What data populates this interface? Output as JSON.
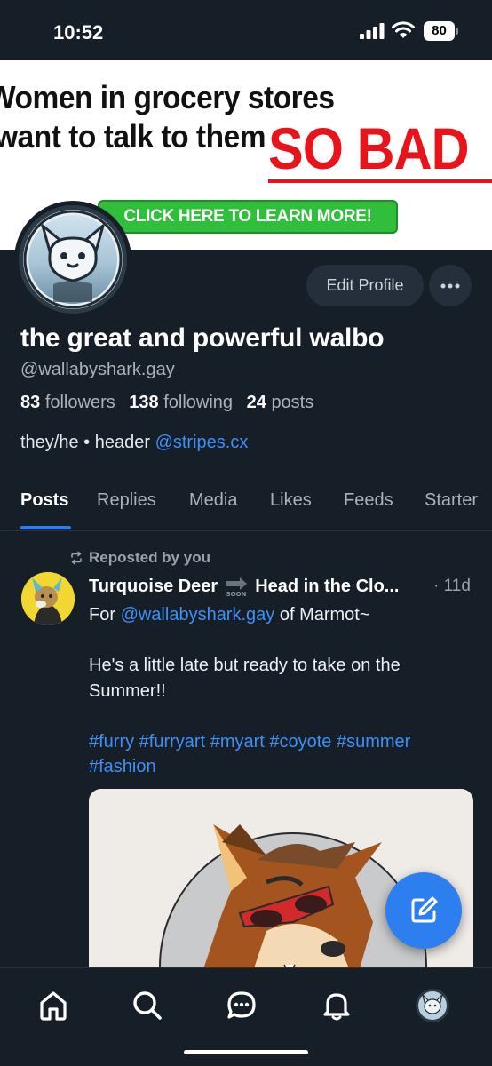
{
  "status_bar": {
    "time": "10:52",
    "battery": "80"
  },
  "banner": {
    "line1": "Women in grocery stores",
    "line2": "want to talk to them",
    "emphasis": "SO BAD",
    "cta": "CLICK HERE TO LEARN MORE!",
    "emphasis_color": "#e8141b",
    "cta_color": "#2fbf3b"
  },
  "profile": {
    "display_name": "the great and powerful walbo",
    "handle": "@wallabyshark.gay",
    "followers_count": "83",
    "followers_label": "followers",
    "following_count": "138",
    "following_label": "following",
    "posts_count": "24",
    "posts_label": "posts",
    "bio_prefix": "they/he • header ",
    "bio_link": "@stripes.cx",
    "edit_label": "Edit Profile",
    "more_icon": "ellipsis-icon"
  },
  "tabs": [
    {
      "label": "Posts",
      "active": true
    },
    {
      "label": "Replies",
      "active": false
    },
    {
      "label": "Media",
      "active": false
    },
    {
      "label": "Likes",
      "active": false
    },
    {
      "label": "Feeds",
      "active": false
    },
    {
      "label": "Starter",
      "active": false
    }
  ],
  "post": {
    "repost_label": "Reposted by you",
    "author": "Turquoise Deer",
    "author_suffix": "Head in the Clo...",
    "time": "· 11d",
    "line1_prefix": "For ",
    "mention": "@wallabyshark.gay",
    "line1_suffix": " of Marmot~",
    "line2": "He's a little late but ready to take on the Summer!!",
    "hashtags_line1": "#furry #furryart #myart #coyote #summer",
    "hashtags_line2": "#fashion"
  },
  "nav": {
    "items": [
      "home-icon",
      "search-icon",
      "chat-icon",
      "bell-icon",
      "profile-avatar-icon"
    ]
  },
  "colors": {
    "background": "#161e27",
    "accent": "#2d7ff0",
    "link": "#3f8ff5"
  }
}
